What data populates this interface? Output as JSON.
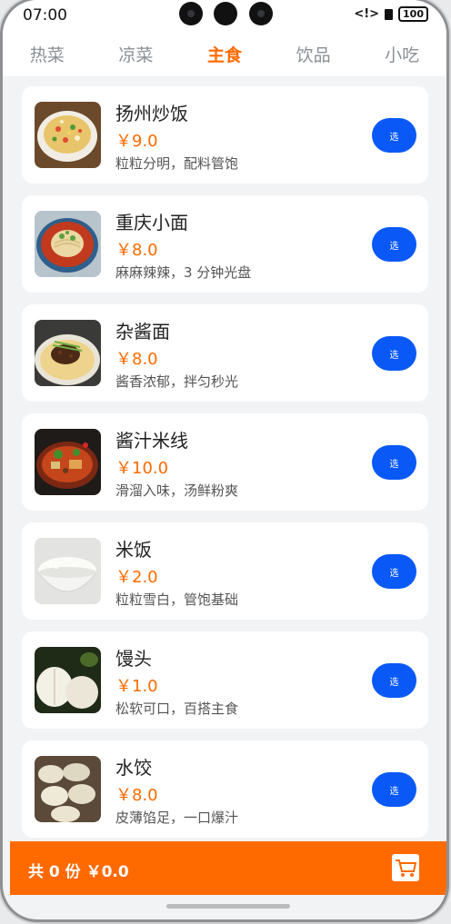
{
  "status": {
    "time": "07:00",
    "signal": "<!>",
    "battery": "100"
  },
  "tabs": [
    {
      "label": "热菜",
      "active": false
    },
    {
      "label": "凉菜",
      "active": false
    },
    {
      "label": "主食",
      "active": true
    },
    {
      "label": "饮品",
      "active": false
    },
    {
      "label": "小吃",
      "active": false
    }
  ],
  "items": [
    {
      "name": "扬州炒饭",
      "price": "￥9.0",
      "desc": "粒粒分明，配料管饱",
      "button": "选"
    },
    {
      "name": "重庆小面",
      "price": "￥8.0",
      "desc": "麻麻辣辣，3 分钟光盘",
      "button": "选"
    },
    {
      "name": "杂酱面",
      "price": "￥8.0",
      "desc": "酱香浓郁，拌匀秒光",
      "button": "选"
    },
    {
      "name": "酱汁米线",
      "price": "￥10.0",
      "desc": "滑溜入味，汤鲜粉爽",
      "button": "选"
    },
    {
      "name": "米饭",
      "price": "￥2.0",
      "desc": "粒粒雪白，管饱基础",
      "button": "选"
    },
    {
      "name": "馒头",
      "price": "￥1.0",
      "desc": "松软可口，百搭主食",
      "button": "选"
    },
    {
      "name": "水饺",
      "price": "￥8.0",
      "desc": "皮薄馅足，一口爆汁",
      "button": "选"
    }
  ],
  "cart": {
    "summary": "共 0 份 ￥0.0"
  },
  "colors": {
    "accent": "#ff6a00",
    "button": "#0a59f7",
    "tab_inactive": "#8a8f95"
  }
}
